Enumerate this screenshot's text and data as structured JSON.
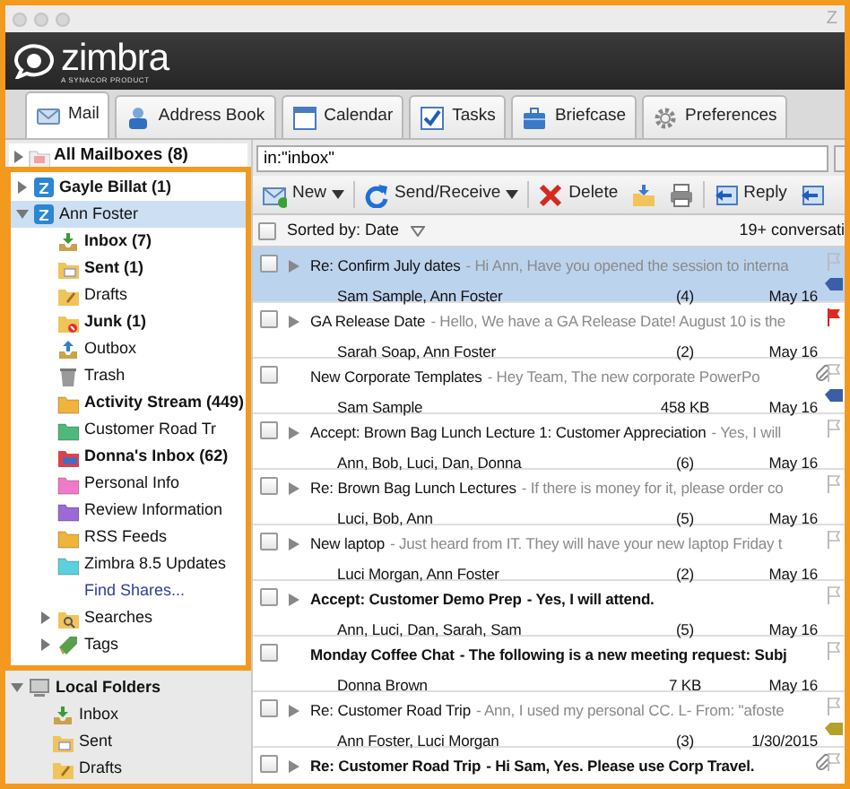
{
  "window": {
    "title": "Z"
  },
  "header": {
    "logo": "zimbra",
    "tagline": "A SYNACOR PRODUCT"
  },
  "tabs": [
    {
      "kind": "mail",
      "label": "Mail",
      "selected": true
    },
    {
      "kind": "contacts",
      "label": "Address Book",
      "selected": false
    },
    {
      "kind": "calendar",
      "label": "Calendar",
      "selected": false
    },
    {
      "kind": "tasks",
      "label": "Tasks",
      "selected": false
    },
    {
      "kind": "briefcase",
      "label": "Briefcase",
      "selected": false
    },
    {
      "kind": "preferences",
      "label": "Preferences",
      "selected": false
    }
  ],
  "sidebar": {
    "all_mailboxes": {
      "label": "All Mailboxes (8)",
      "expanded": false
    },
    "accounts": [
      {
        "label": "Gayle Billat (1)",
        "unread": true,
        "expanded": false,
        "selected": false
      },
      {
        "label": "Ann Foster",
        "unread": false,
        "expanded": true,
        "selected": true,
        "children": [
          {
            "kind": "inbox",
            "label": "Inbox (7)",
            "unread": true
          },
          {
            "kind": "sent",
            "label": "Sent (1)",
            "unread": true
          },
          {
            "kind": "drafts",
            "label": "Drafts",
            "unread": false
          },
          {
            "kind": "junk",
            "label": "Junk (1)",
            "unread": true
          },
          {
            "kind": "outbox",
            "label": "Outbox",
            "unread": false
          },
          {
            "kind": "trash",
            "label": "Trash",
            "unread": false
          },
          {
            "kind": "folder",
            "label": "Activity Stream (449)",
            "unread": true,
            "color": "#f0b43c"
          },
          {
            "kind": "folder",
            "label": "Customer Road Tr",
            "unread": false,
            "color": "#4fb87a"
          },
          {
            "kind": "shared",
            "label": "Donna's Inbox (62)",
            "unread": true
          },
          {
            "kind": "folder",
            "label": "Personal Info",
            "unread": false,
            "color": "#f07ac8"
          },
          {
            "kind": "folder",
            "label": "Review Information",
            "unread": false,
            "color": "#9b6ad6"
          },
          {
            "kind": "folder",
            "label": "RSS Feeds",
            "unread": false,
            "color": "#f0b43c"
          },
          {
            "kind": "folder",
            "label": "Zimbra 8.5 Updates",
            "unread": false,
            "color": "#5cd0dc"
          },
          {
            "kind": "link",
            "label": "Find Shares..."
          },
          {
            "kind": "searches",
            "label": "Searches",
            "expanded": false
          },
          {
            "kind": "tags",
            "label": "Tags",
            "expanded": false
          }
        ]
      }
    ],
    "local_folders": {
      "label": "Local Folders",
      "expanded": true,
      "children": [
        {
          "kind": "inbox",
          "label": "Inbox",
          "unread": false
        },
        {
          "kind": "sent",
          "label": "Sent",
          "unread": false
        },
        {
          "kind": "drafts",
          "label": "Drafts",
          "unread": false
        }
      ]
    }
  },
  "search": {
    "value": "in:\"inbox\""
  },
  "toolbar": [
    {
      "kind": "new",
      "label": "New",
      "menu": true
    },
    {
      "kind": "send",
      "label": "Send/Receive",
      "menu": true
    },
    {
      "kind": "delete",
      "label": "Delete",
      "menu": false
    },
    {
      "kind": "move",
      "menu": false
    },
    {
      "kind": "print",
      "menu": false
    },
    {
      "kind": "reply",
      "label": "Reply",
      "menu": false
    },
    {
      "kind": "reply_all",
      "menu": false
    }
  ],
  "list_header": {
    "checked": false,
    "sort": "Sorted by: Date",
    "count": "19+ conversati"
  },
  "messages": [
    {
      "kind": "conversation",
      "subject": "Re: Confirm July dates",
      "preview": "- Hi Ann, Have you opened the session to interna",
      "from": "Sam Sample, Ann Foster",
      "count": "(4)",
      "date": "May 16",
      "unread": false,
      "selected": true,
      "flagged": false,
      "attachment": false,
      "tag": {
        "color": "#3a5ea8"
      }
    },
    {
      "kind": "conversation",
      "subject": "GA Release Date",
      "preview": "- Hello, We have a GA Release Date! August 10 is the",
      "from": "Sarah Soap, Ann Foster",
      "count": "(2)",
      "date": "May 16",
      "unread": false,
      "selected": false,
      "flagged": true,
      "attachment": false
    },
    {
      "kind": "message",
      "subject": "New Corporate Templates",
      "preview": "- Hey Team, The new corporate PowerPo",
      "from": "Sam Sample",
      "count": "458 KB",
      "date": "May 16",
      "unread": false,
      "selected": false,
      "flagged": false,
      "attachment": true,
      "tag": {
        "color": "#3a5ea8"
      }
    },
    {
      "kind": "conversation",
      "subject": "Accept: Brown Bag Lunch Lecture 1: Customer Appreciation",
      "preview": "- Yes, I will",
      "from": "Ann, Bob, Luci, Dan, Donna",
      "count": "(6)",
      "date": "May 16",
      "unread": false,
      "selected": false,
      "flagged": false,
      "attachment": false
    },
    {
      "kind": "conversation",
      "subject": "Re: Brown Bag Lunch Lectures",
      "preview": "- If there is money for it, please order co",
      "from": "Luci, Bob, Ann",
      "count": "(5)",
      "date": "May 16",
      "unread": false,
      "selected": false,
      "flagged": false,
      "attachment": false
    },
    {
      "kind": "conversation",
      "subject": "New laptop",
      "preview": "- Just heard from IT. They will have your new laptop Friday t",
      "from": "Luci Morgan, Ann Foster",
      "count": "(2)",
      "date": "May 16",
      "unread": false,
      "selected": false,
      "flagged": false,
      "attachment": false
    },
    {
      "kind": "conversation",
      "subject": "Accept: Customer Demo Prep",
      "preview": "- Yes, I will attend.",
      "from": "Ann, Luci, Dan, Sarah, Sam",
      "count": "(5)",
      "date": "May 16",
      "unread": true,
      "selected": false,
      "flagged": false,
      "attachment": false
    },
    {
      "kind": "message",
      "subject": "Monday Coffee Chat",
      "preview": "- The following is a new meeting request: Subj",
      "from": "Donna Brown",
      "count": "7 KB",
      "date": "May 16",
      "unread": true,
      "selected": false,
      "flagged": false,
      "attachment": false
    },
    {
      "kind": "conversation",
      "subject": "Re: Customer Road Trip",
      "preview": "- Ann, I used my personal CC. L- From: \"afoste",
      "from": "Ann Foster, Luci Morgan",
      "count": "(3)",
      "date": "1/30/2015",
      "unread": false,
      "selected": false,
      "flagged": false,
      "attachment": false,
      "tag": {
        "color": "#b3a12a"
      }
    },
    {
      "kind": "conversation",
      "subject": "Re: Customer Road Trip",
      "preview": "- Hi Sam, Yes. Please use Corp Travel.",
      "unread": true,
      "selected": false,
      "flagged": false,
      "attachment": true
    }
  ]
}
